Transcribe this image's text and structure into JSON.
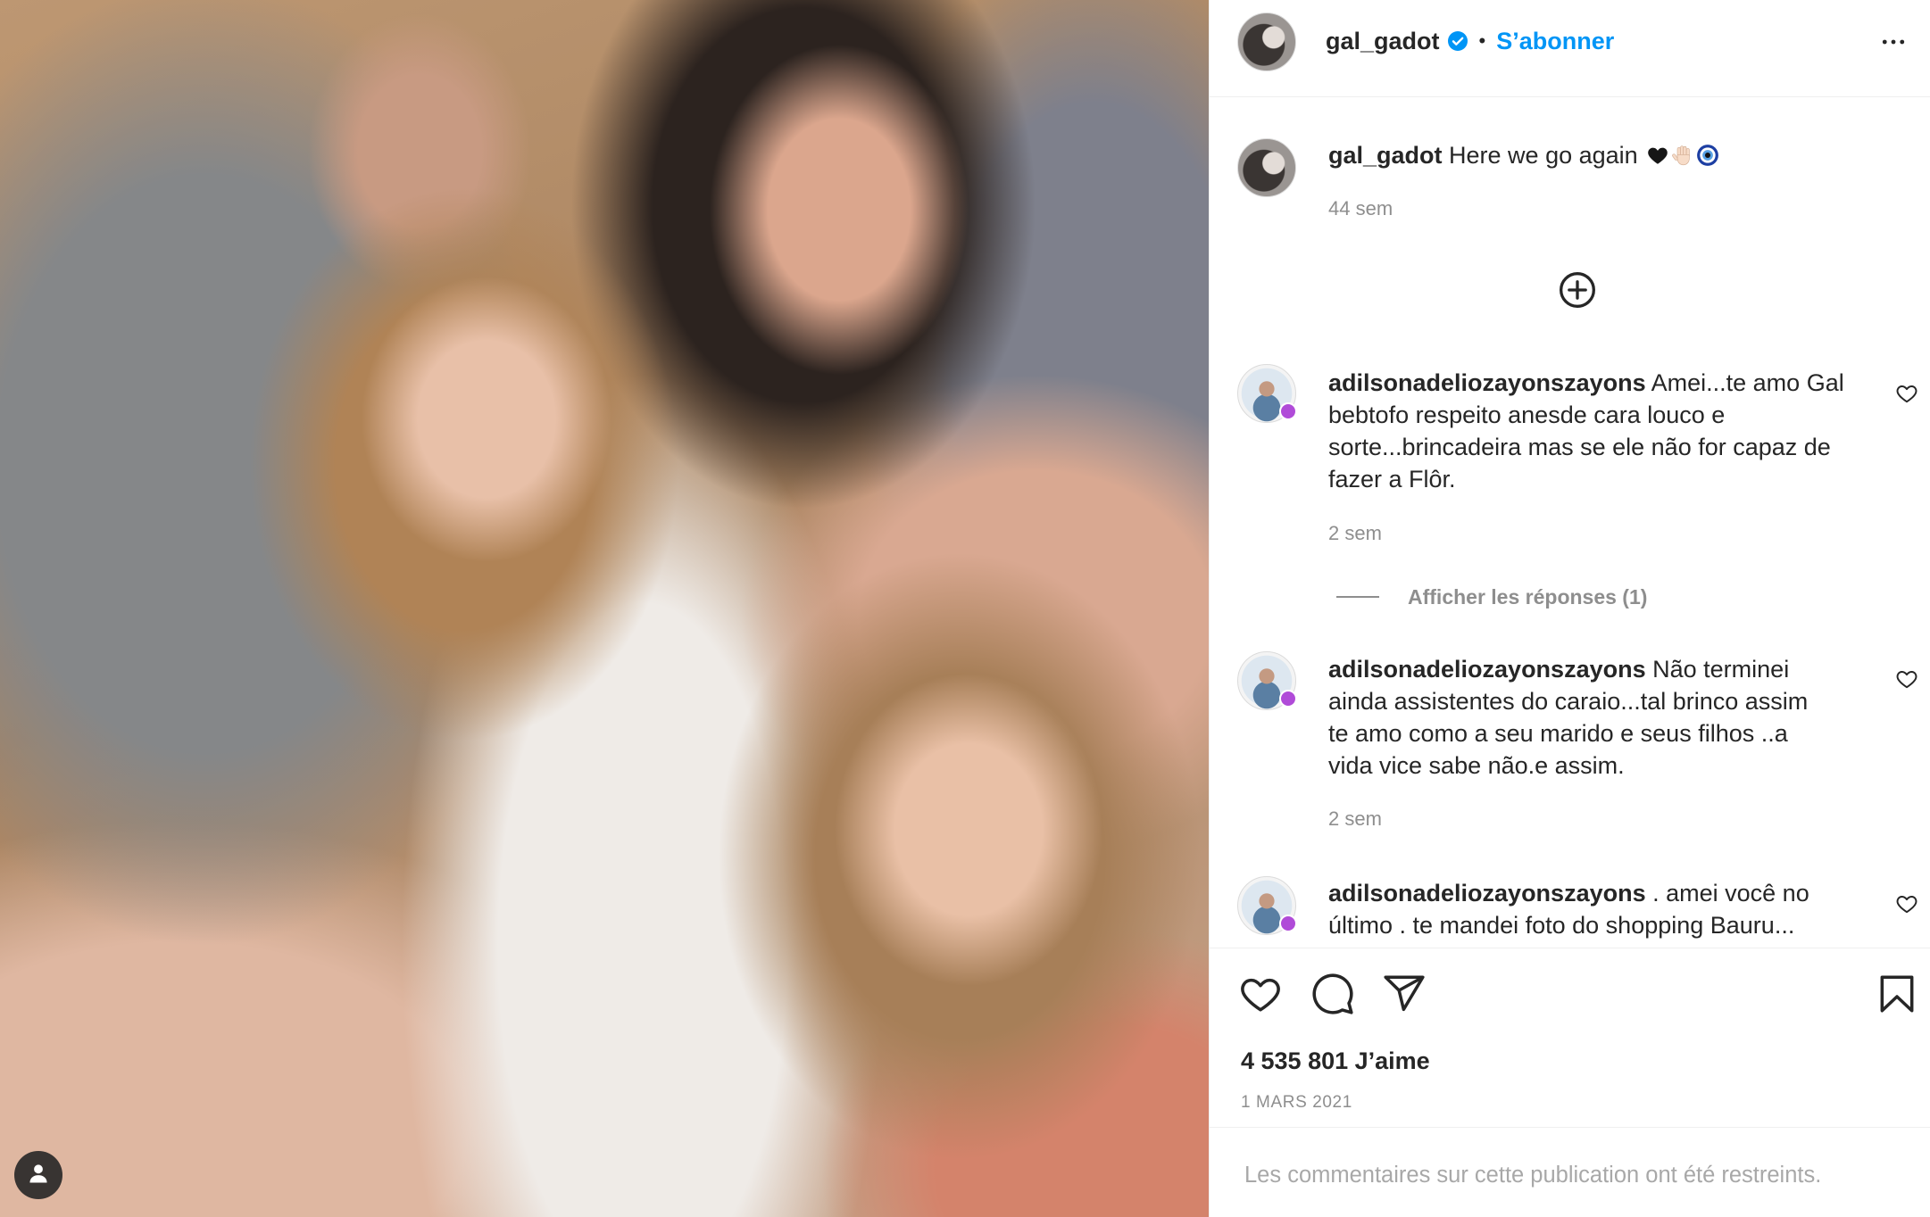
{
  "photo": {
    "tag_icon": "user-tag-icon"
  },
  "header": {
    "username": "gal_gadot",
    "verified_icon": "verified-badge-icon",
    "separator": "•",
    "follow_label": "S’abonner",
    "more_icon": "more-options-icon"
  },
  "caption": {
    "username": "gal_gadot",
    "text": "Here we go again",
    "emoji_icons": [
      "black-heart-emoji",
      "raised-hand-light-skin-tone-emoji",
      "nazar-amulet-emoji"
    ],
    "time": "44 sem"
  },
  "load_more_icon": "plus-circle-icon",
  "comments": [
    {
      "username": "adilsonadeliozayonszayons",
      "text": "Amei...te amo Gal\nbebtofo respeito anesde cara louco e\nsorte...brincadeira mas se ele não for capaz de\nfazer a Flôr.",
      "time": "2 sem",
      "replies_label": "Afficher les réponses (1)"
    },
    {
      "username": "adilsonadeliozayonszayons",
      "text": "Não terminei\nainda assistentes do caraio...tal brinco assim\nte amo como a seu marido e seus filhos ..a\nvida vice sabe não.e assim.",
      "time": "2 sem"
    },
    {
      "username": "adilsonadeliozayonszayons",
      "text": ". amei você no\núltimo . te mandei foto do shopping Bauru..."
    }
  ],
  "actions": {
    "like_icon": "heart-outline-icon",
    "comment_icon": "comment-bubble-icon",
    "share_icon": "paper-plane-icon",
    "save_icon": "bookmark-icon"
  },
  "likes": "4 535 801 J’aime",
  "date": "1 MARS 2021",
  "restricted_notice": "Les commentaires sur cette publication ont été restreints.",
  "colors": {
    "accent": "#0095f6",
    "text": "#262626",
    "secondary_text": "#8e8e8e",
    "divider": "#efefef"
  }
}
